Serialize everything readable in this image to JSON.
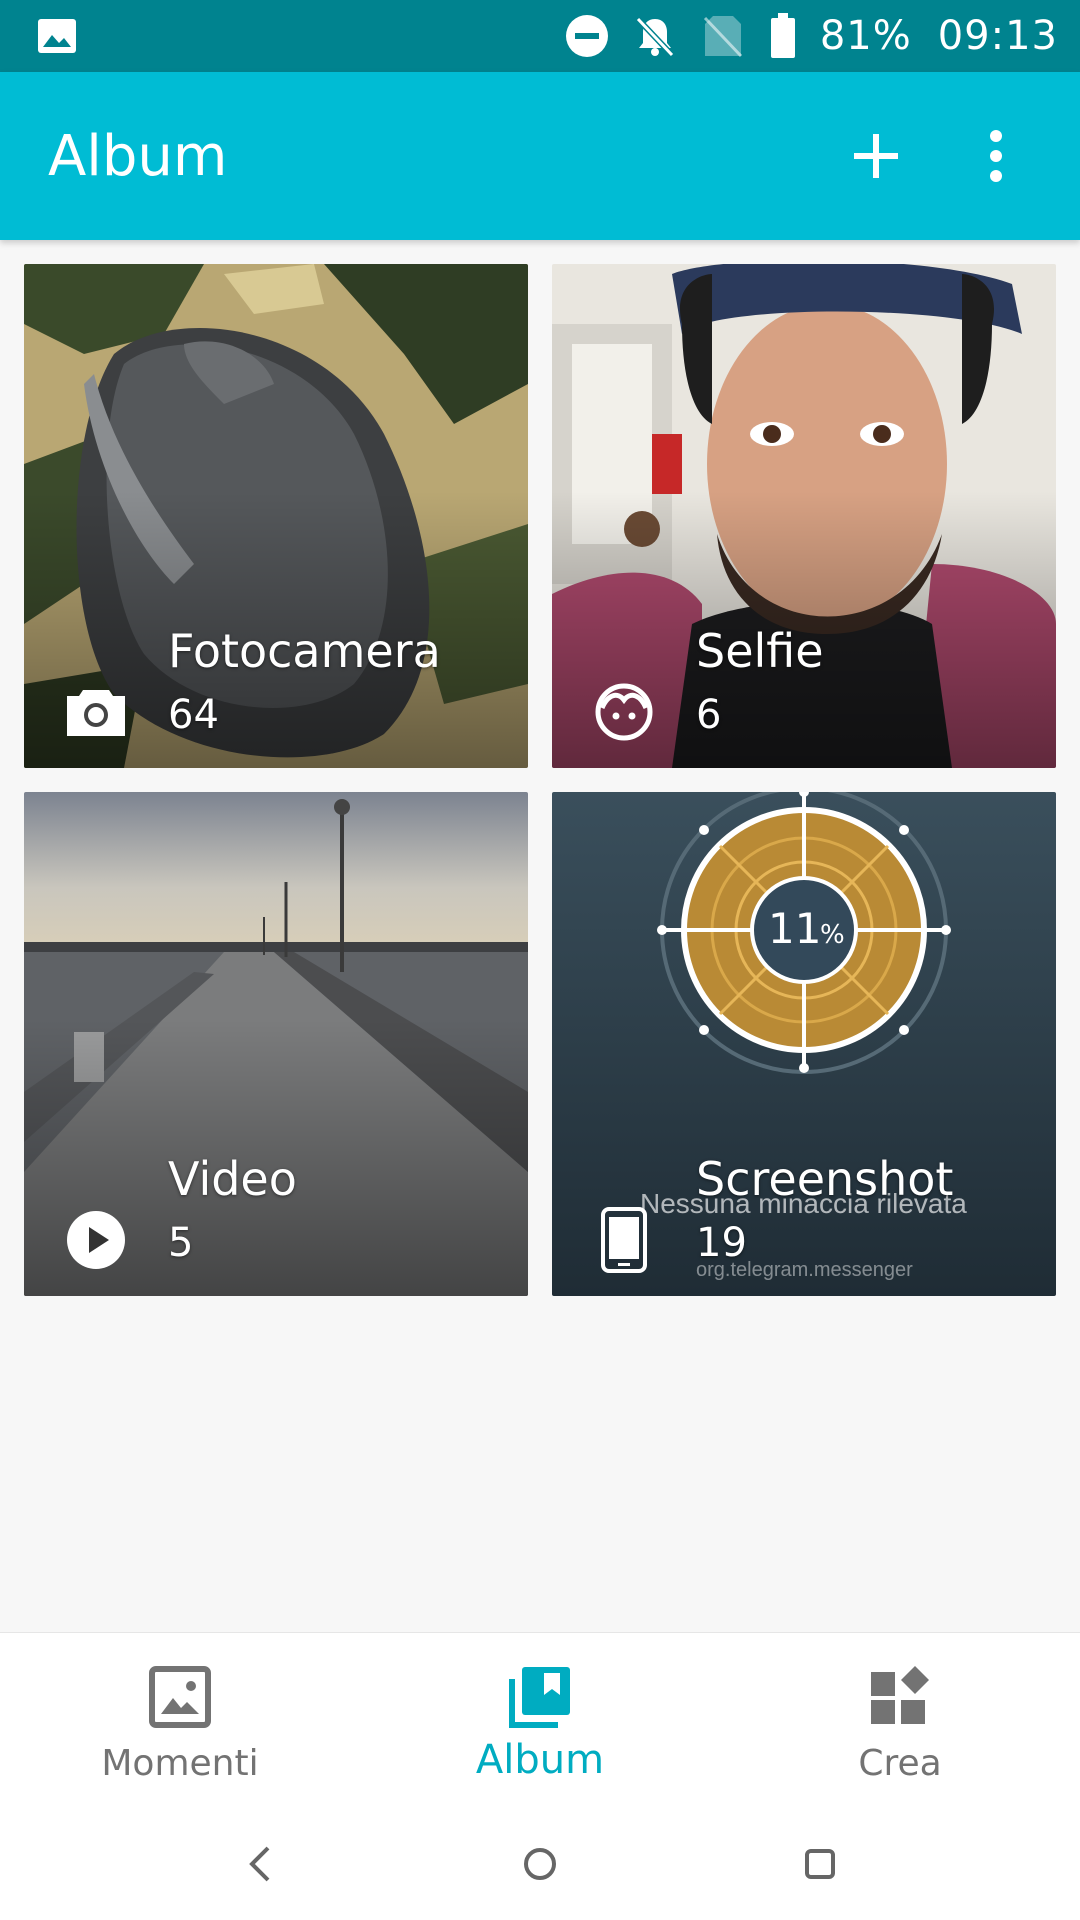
{
  "status_bar": {
    "battery": "81%",
    "time": "09:13",
    "icons": [
      "gallery-notification-icon",
      "do-not-disturb-icon",
      "notifications-off-icon",
      "no-sim-icon",
      "battery-icon"
    ]
  },
  "app_bar": {
    "title": "Album",
    "actions": [
      "add-icon",
      "more-options-icon"
    ]
  },
  "albums": [
    {
      "name": "Fotocamera",
      "count": "64",
      "icon": "camera-icon"
    },
    {
      "name": "Selfie",
      "count": "6",
      "icon": "selfie-face-icon"
    },
    {
      "name": "Video",
      "count": "5",
      "icon": "play-icon"
    },
    {
      "name": "Screenshot",
      "count": "19",
      "icon": "phone-icon"
    }
  ],
  "screenshot_preview": {
    "percent": "11",
    "percent_sign": "%",
    "toast_message": "Nessuna minaccia rilevata",
    "toast_sub": "org.telegram.messenger"
  },
  "bottom_nav": {
    "items": [
      {
        "label": "Momenti",
        "icon": "image-icon",
        "active": false
      },
      {
        "label": "Album",
        "icon": "album-icon",
        "active": true
      },
      {
        "label": "Crea",
        "icon": "create-icon",
        "active": false
      }
    ]
  },
  "colors": {
    "status_bar": "#00838f",
    "app_bar": "#00bcd4",
    "accent": "#00acc1",
    "inactive": "#737373"
  }
}
